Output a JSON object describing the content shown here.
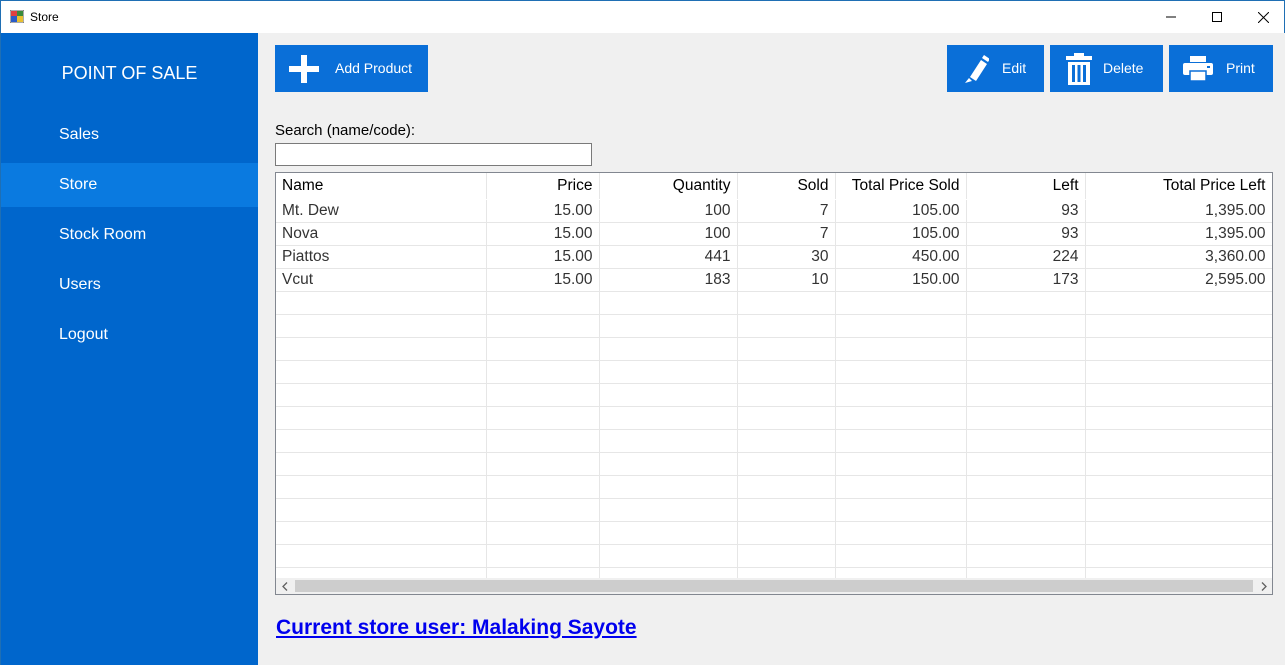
{
  "window": {
    "title": "Store",
    "minimize_icon": "minimize-icon",
    "maximize_icon": "maximize-icon",
    "close_icon": "close-icon"
  },
  "sidebar": {
    "brand": "POINT OF SALE",
    "color": "#0066cc",
    "active_color": "#0a7ae0",
    "items": [
      {
        "label": "Sales"
      },
      {
        "label": "Store"
      },
      {
        "label": "Stock Room"
      },
      {
        "label": "Users"
      },
      {
        "label": "Logout"
      }
    ],
    "active": "Store"
  },
  "toolbar": {
    "add_label": "Add Product",
    "edit_label": "Edit",
    "delete_label": "Delete",
    "print_label": "Print",
    "button_color": "#0a6fd8"
  },
  "search": {
    "label": "Search (name/code):",
    "value": "",
    "placeholder": ""
  },
  "table": {
    "columns": [
      "Name",
      "Price",
      "Quantity",
      "Sold",
      "Total Price Sold",
      "Left",
      "Total Price Left"
    ],
    "rows": [
      [
        "Mt. Dew",
        "15.00",
        "100",
        "7",
        "105.00",
        "93",
        "1,395.00"
      ],
      [
        "Nova",
        "15.00",
        "100",
        "7",
        "105.00",
        "93",
        "1,395.00"
      ],
      [
        "Piattos",
        "15.00",
        "441",
        "30",
        "450.00",
        "224",
        "3,360.00"
      ],
      [
        "Vcut",
        "15.00",
        "183",
        "10",
        "150.00",
        "173",
        "2,595.00"
      ]
    ]
  },
  "footer": {
    "current_user": "Current store user: Malaking Sayote"
  }
}
